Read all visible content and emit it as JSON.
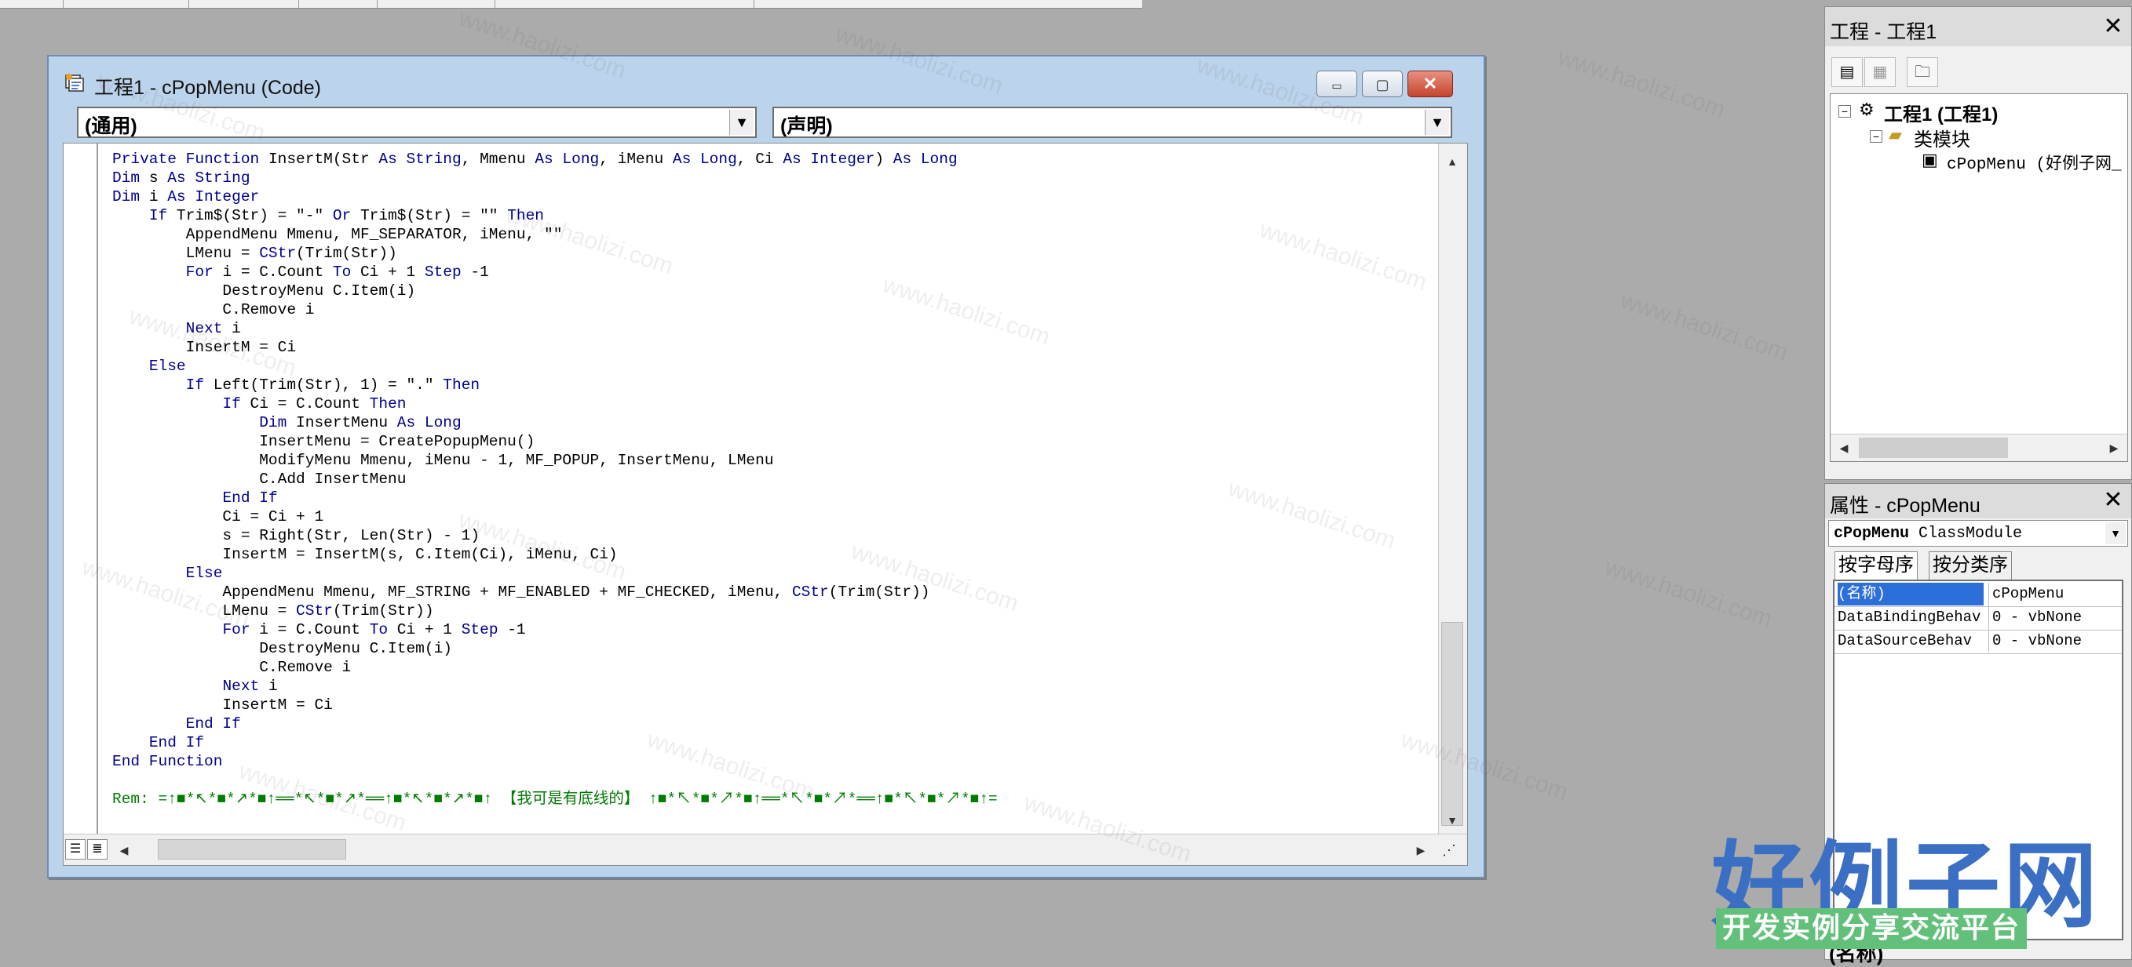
{
  "code_window": {
    "title": "工程1 - cPopMenu (Code)",
    "object_dropdown": "(通用)",
    "procedure_dropdown": "(声明)",
    "minimize_symbol": "▭",
    "restore_symbol": "▢",
    "close_symbol": "✕",
    "code_lines": [
      [
        {
          "t": "Private Function ",
          "k": "kw"
        },
        {
          "t": "InsertM(Str "
        },
        {
          "t": "As String",
          "k": "kw"
        },
        {
          "t": ", Mmenu "
        },
        {
          "t": "As Long",
          "k": "kw"
        },
        {
          "t": ", iMenu "
        },
        {
          "t": "As Long",
          "k": "kw"
        },
        {
          "t": ", Ci "
        },
        {
          "t": "As Integer",
          "k": "kw"
        },
        {
          "t": ") "
        },
        {
          "t": "As Long",
          "k": "kw"
        }
      ],
      [
        {
          "t": "Dim ",
          "k": "kw"
        },
        {
          "t": "s "
        },
        {
          "t": "As String",
          "k": "kw"
        }
      ],
      [
        {
          "t": "Dim ",
          "k": "kw"
        },
        {
          "t": "i "
        },
        {
          "t": "As Integer",
          "k": "kw"
        }
      ],
      [
        {
          "t": "    "
        },
        {
          "t": "If ",
          "k": "kw"
        },
        {
          "t": "Trim$(Str) = \"-\" "
        },
        {
          "t": "Or ",
          "k": "kw"
        },
        {
          "t": "Trim$(Str) = \"\" "
        },
        {
          "t": "Then",
          "k": "kw"
        }
      ],
      [
        {
          "t": "        AppendMenu Mmenu, MF_SEPARATOR, iMenu, \"\""
        }
      ],
      [
        {
          "t": "        LMenu = "
        },
        {
          "t": "CStr",
          "k": "kw"
        },
        {
          "t": "(Trim(Str))"
        }
      ],
      [
        {
          "t": "        "
        },
        {
          "t": "For ",
          "k": "kw"
        },
        {
          "t": "i = C.Count "
        },
        {
          "t": "To ",
          "k": "kw"
        },
        {
          "t": "Ci + 1 "
        },
        {
          "t": "Step ",
          "k": "kw"
        },
        {
          "t": "-1"
        }
      ],
      [
        {
          "t": "            DestroyMenu C.Item(i)"
        }
      ],
      [
        {
          "t": "            C.Remove i"
        }
      ],
      [
        {
          "t": "        "
        },
        {
          "t": "Next ",
          "k": "kw"
        },
        {
          "t": "i"
        }
      ],
      [
        {
          "t": "        InsertM = Ci"
        }
      ],
      [
        {
          "t": "    "
        },
        {
          "t": "Else",
          "k": "kw"
        }
      ],
      [
        {
          "t": "        "
        },
        {
          "t": "If ",
          "k": "kw"
        },
        {
          "t": "Left(Trim(Str), 1) = \".\" "
        },
        {
          "t": "Then",
          "k": "kw"
        }
      ],
      [
        {
          "t": "            "
        },
        {
          "t": "If ",
          "k": "kw"
        },
        {
          "t": "Ci = C.Count "
        },
        {
          "t": "Then",
          "k": "kw"
        }
      ],
      [
        {
          "t": "                "
        },
        {
          "t": "Dim ",
          "k": "kw"
        },
        {
          "t": "InsertMenu "
        },
        {
          "t": "As Long",
          "k": "kw"
        }
      ],
      [
        {
          "t": "                InsertMenu = CreatePopupMenu()"
        }
      ],
      [
        {
          "t": "                ModifyMenu Mmenu, iMenu - 1, MF_POPUP, InsertMenu, LMenu"
        }
      ],
      [
        {
          "t": "                C.Add InsertMenu"
        }
      ],
      [
        {
          "t": "            "
        },
        {
          "t": "End If",
          "k": "kw"
        }
      ],
      [
        {
          "t": "            Ci = Ci + 1"
        }
      ],
      [
        {
          "t": "            s = Right(Str, Len(Str) - 1)"
        }
      ],
      [
        {
          "t": "            InsertM = InsertM(s, C.Item(Ci), iMenu, Ci)"
        }
      ],
      [
        {
          "t": "        "
        },
        {
          "t": "Else",
          "k": "kw"
        }
      ],
      [
        {
          "t": "            AppendMenu Mmenu, MF_STRING + MF_ENABLED + MF_CHECKED, iMenu, "
        },
        {
          "t": "CStr",
          "k": "kw"
        },
        {
          "t": "(Trim(Str))"
        }
      ],
      [
        {
          "t": "            LMenu = "
        },
        {
          "t": "CStr",
          "k": "kw"
        },
        {
          "t": "(Trim(Str))"
        }
      ],
      [
        {
          "t": "            "
        },
        {
          "t": "For ",
          "k": "kw"
        },
        {
          "t": "i = C.Count "
        },
        {
          "t": "To ",
          "k": "kw"
        },
        {
          "t": "Ci + 1 "
        },
        {
          "t": "Step ",
          "k": "kw"
        },
        {
          "t": "-1"
        }
      ],
      [
        {
          "t": "                DestroyMenu C.Item(i)"
        }
      ],
      [
        {
          "t": "                C.Remove i"
        }
      ],
      [
        {
          "t": "            "
        },
        {
          "t": "Next ",
          "k": "kw"
        },
        {
          "t": "i"
        }
      ],
      [
        {
          "t": "            InsertM = Ci"
        }
      ],
      [
        {
          "t": "        "
        },
        {
          "t": "End If",
          "k": "kw"
        }
      ],
      [
        {
          "t": "    "
        },
        {
          "t": "End If",
          "k": "kw"
        }
      ],
      [
        {
          "t": "End Function",
          "k": "kw"
        }
      ],
      [
        {
          "t": ""
        }
      ],
      [
        {
          "t": "Rem: =↑■*↖*■*↗*■↑══*↖*■*↗*══↑■*↖*■*↗*■↑ 【我可是有底线的】 ↑■*↖*■*↗*■↑══*↖*■*↗*══↑■*↖*■*↗*■↑=",
          "k": "cm"
        }
      ]
    ]
  },
  "project_panel": {
    "title": "工程 - 工程1",
    "close_symbol": "✕",
    "tree": {
      "root": "工程1 (工程1)",
      "folder": "类模块",
      "item": "cPopMenu (好例子网_"
    }
  },
  "properties_panel": {
    "title": "属性 - cPopMenu",
    "close_symbol": "✕",
    "object_name": "cPopMenu",
    "object_type": "ClassModule",
    "tabs": [
      "按字母序",
      "按分类序"
    ],
    "rows": [
      {
        "name": "(名称)",
        "value": "cPopMenu"
      },
      {
        "name": "DataBindingBehav",
        "value": "0 - vbNone"
      },
      {
        "name": "DataSourceBehav",
        "value": "0 - vbNone"
      }
    ],
    "bottom_partial": "(名称)"
  },
  "watermark": {
    "url": "www.haolizi.com",
    "logo": "好例子网",
    "tagline": "开发实例分享交流平台"
  }
}
